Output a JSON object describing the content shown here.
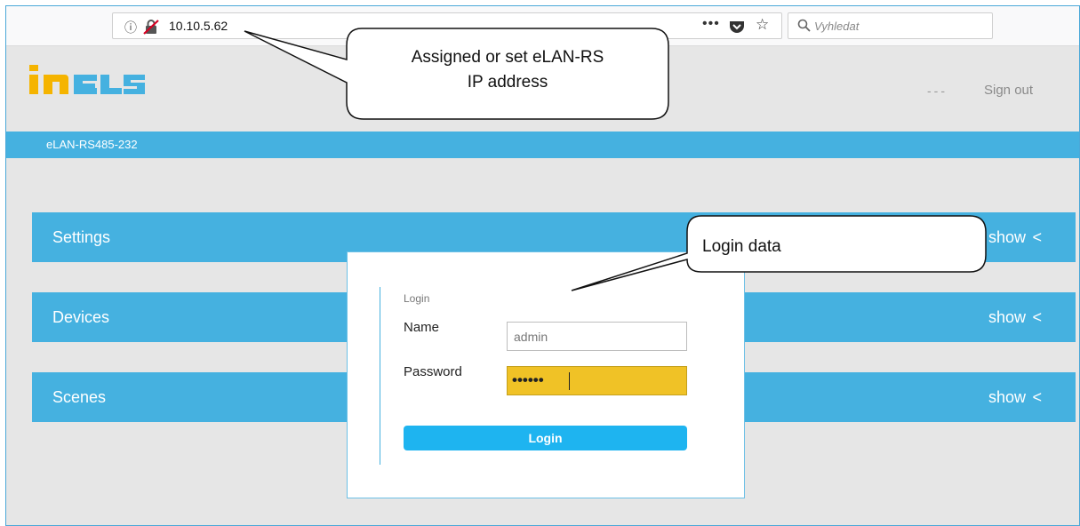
{
  "browser": {
    "url": "10.10.5.62",
    "info_icon": "info-icon",
    "lock_icon": "insecure-lock-icon",
    "menu_dots": "•••",
    "search_placeholder": "Vyhledat"
  },
  "header": {
    "logo_text": "iNELS",
    "dashes": "---",
    "sign_out": "Sign out"
  },
  "device_bar": {
    "name": "eLAN-RS485-232"
  },
  "sections": [
    {
      "title": "Settings",
      "show": "show",
      "chevron": "<"
    },
    {
      "title": "Devices",
      "show": "show",
      "chevron": "<"
    },
    {
      "title": "Scenes",
      "show": "show",
      "chevron": "<"
    }
  ],
  "login": {
    "heading": "Login",
    "name_label": "Name",
    "name_value": "admin",
    "password_label": "Password",
    "password_dots": "••••••",
    "button": "Login"
  },
  "callouts": {
    "ip_line1": "Assigned or set eLAN-RS",
    "ip_line2": "IP address",
    "login_data": "Login data"
  },
  "colors": {
    "accent": "#45b1e0",
    "button": "#1eb4f0",
    "password_fill": "#f0c226",
    "logo_yellow": "#f5b400",
    "logo_blue": "#45b1e0"
  }
}
